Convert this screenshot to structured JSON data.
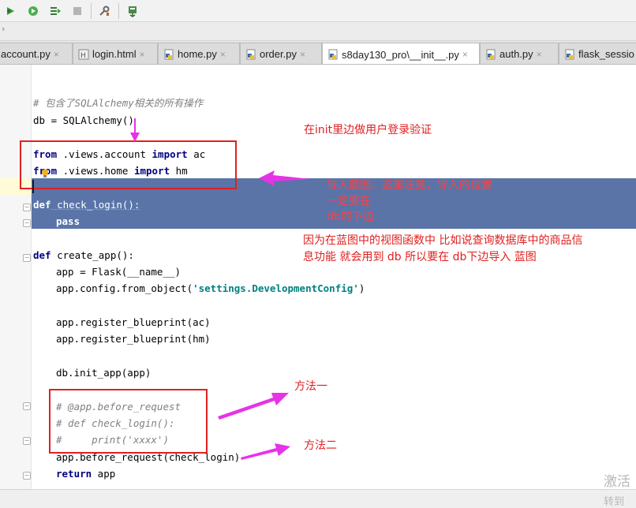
{
  "toolbar": {
    "buttons": [
      "debug-icon",
      "run-coverage-icon",
      "run-to-cursor-icon",
      "stop-icon",
      "settings-tools-icon",
      "deploy-icon"
    ]
  },
  "tabs": [
    {
      "label": "account.py",
      "icon": "python-file-icon"
    },
    {
      "label": "login.html",
      "icon": "html-file-icon"
    },
    {
      "label": "home.py",
      "icon": "python-file-icon"
    },
    {
      "label": "order.py",
      "icon": "python-file-icon"
    },
    {
      "label": "s8day130_pro\\__init__.py",
      "icon": "python-file-icon",
      "active": true
    },
    {
      "label": "auth.py",
      "icon": "python-file-icon"
    },
    {
      "label": "flask_sessio",
      "icon": "python-file-icon"
    }
  ],
  "code": {
    "l1": "# 包含了SQLAlchemy相关的所有操作",
    "l2": "db = SQLAlchemy()",
    "l3_kw": "from",
    "l3_mid": " .views.account ",
    "l3_kw2": "import",
    "l3_end": " ac",
    "l4_kw": "from",
    "l4_mid": " .views.home ",
    "l4_kw2": "import",
    "l4_end": " hm",
    "l5_kw": "def",
    "l5_rest": " check_login():",
    "l6_kw": "pass",
    "l7_kw": "def",
    "l7_rest": " create_app():",
    "l8": "app = Flask(__name__)",
    "l9_pre": "app.config.from_object(",
    "l9_str": "'settings.DevelopmentConfig'",
    "l9_post": ")",
    "l10": "app.register_blueprint(ac)",
    "l11": "app.register_blueprint(hm)",
    "l12": "db.init_app(app)",
    "l13": "# @app.before_request",
    "l14": "# def check_login():",
    "l15": "#     print('xxxx')",
    "l16": "app.before_request(check_login)",
    "l17_kw": "return",
    "l17_rest": " app"
  },
  "annotations": {
    "a1": "在init里边做用户登录验证",
    "a2_l1": "导入蓝图，这里注意，导入的位置",
    "a2_l2": "一定要在",
    "a2_l3": "db的下边",
    "a3_l1": "因为在蓝图中的视图函数中  比如说查询数据库中的商品信",
    "a3_l2": "息功能 就会用到 db  所以要在  db下边导入 蓝图",
    "a4": "方法一",
    "a5": "方法二"
  },
  "watermark": {
    "line1": "激活",
    "line2": "转到"
  },
  "colors": {
    "annotation": "#e02020",
    "arrow": "#e633e6",
    "selection": "#5a74a8",
    "keyword": "#000080",
    "string": "#008080",
    "comment": "#808080"
  }
}
